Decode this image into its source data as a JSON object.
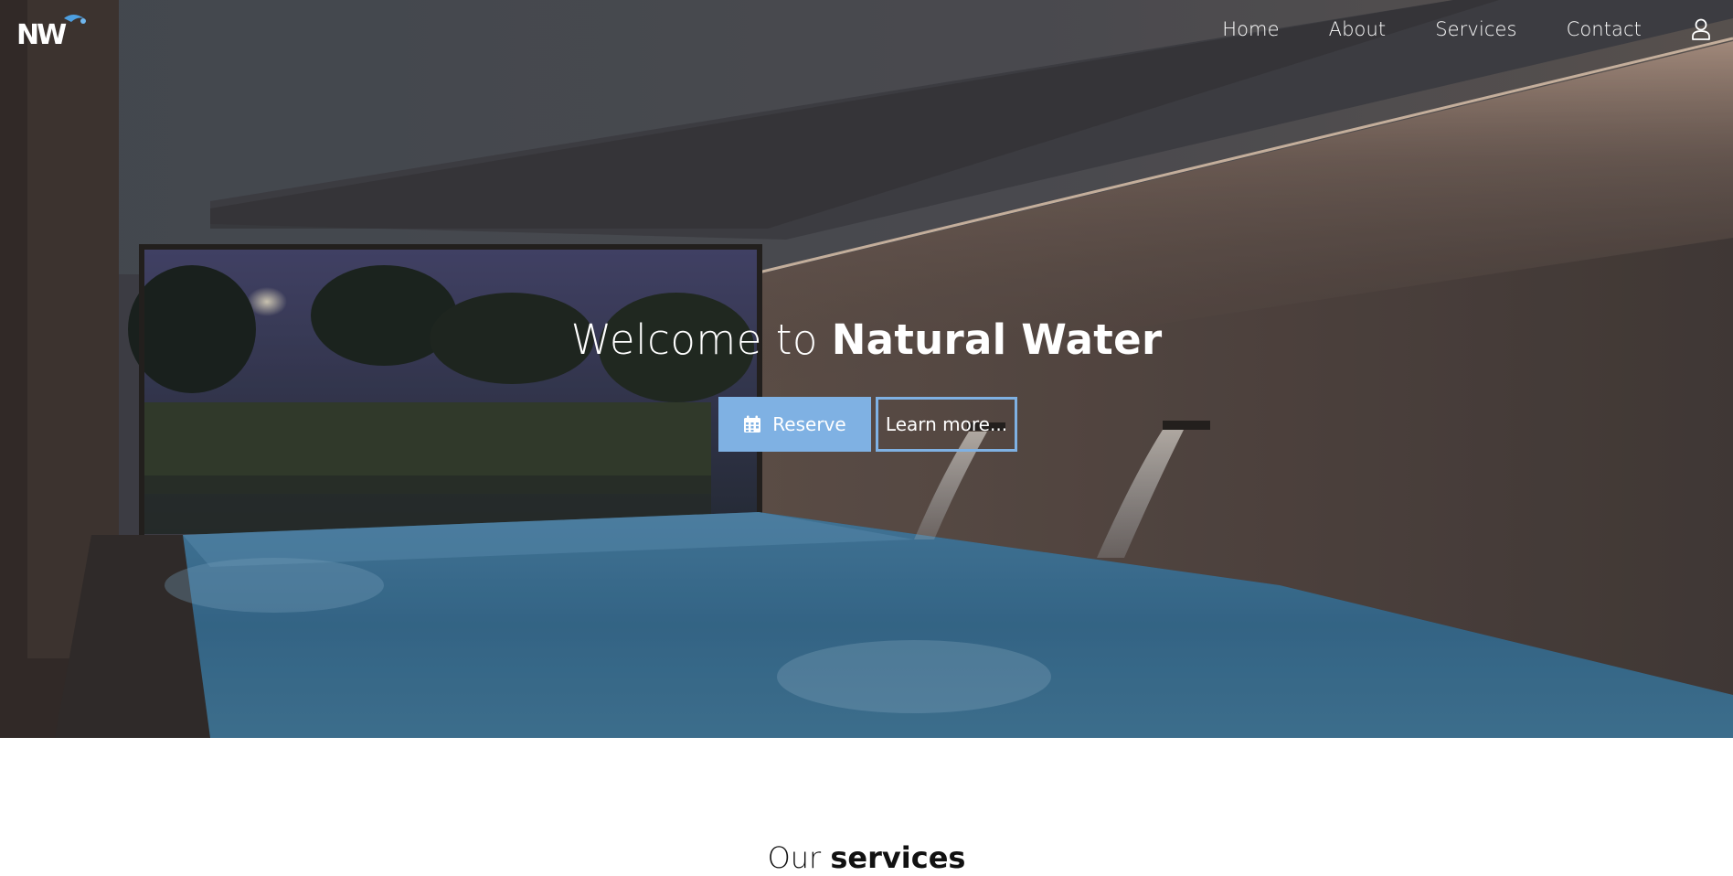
{
  "brand": {
    "logo_text": "NW",
    "accent_color": "#7fb1e3"
  },
  "nav": {
    "items": [
      {
        "label": "Home"
      },
      {
        "label": "About"
      },
      {
        "label": "Services"
      },
      {
        "label": "Contact"
      }
    ],
    "account_icon": "user-icon"
  },
  "hero": {
    "title_light": "Welcome to ",
    "title_bold": "Natural Water",
    "reserve_label": "Reserve",
    "reserve_icon": "calendar-icon",
    "learn_more_label": "Learn more..."
  },
  "services": {
    "heading_light": "Our ",
    "heading_bold": "services"
  }
}
